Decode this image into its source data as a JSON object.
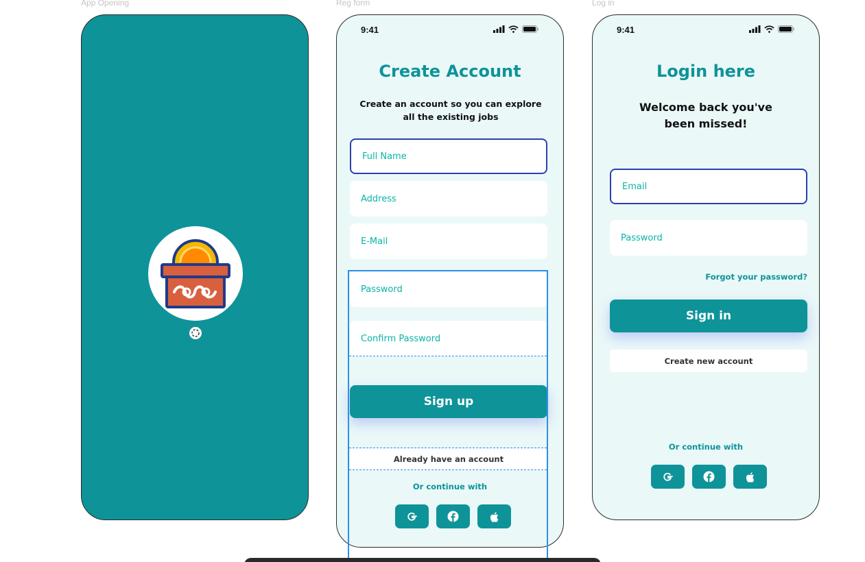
{
  "frames": {
    "splash_label": "App Opening",
    "reg_label": "Reg form",
    "login_label": "Log in"
  },
  "status_bar": {
    "time": "9:41"
  },
  "register": {
    "title": "Create Account",
    "subtitle_line1": "Create an account so you can explore",
    "subtitle_line2": "all the existing jobs",
    "fields": {
      "full_name": "Full Name",
      "address": "Address",
      "email": "E-Mail",
      "password": "Password",
      "confirm_password": "Confirm Password"
    },
    "sign_up": "Sign up",
    "have_account": "Already have an account",
    "continue_with": "Or continue with"
  },
  "login": {
    "title": "Login here",
    "subtitle_line1": "Welcome back you've",
    "subtitle_line2": "been missed!",
    "fields": {
      "email": "Email",
      "password": "Password"
    },
    "forgot": "Forgot your password?",
    "sign_in": "Sign in",
    "create_account": "Create new account",
    "continue_with": "Or continue with"
  },
  "colors": {
    "primary": "#0e9399",
    "screen_bg": "#eaf8f8",
    "field_text": "#0ab3a7",
    "focus_border": "#2b3fb0",
    "selection": "#2f8fe6"
  },
  "icons": [
    "signal-icon",
    "wifi-icon",
    "battery-icon",
    "google-icon",
    "facebook-icon",
    "apple-icon",
    "donation-box-icon",
    "loading-icon"
  ]
}
